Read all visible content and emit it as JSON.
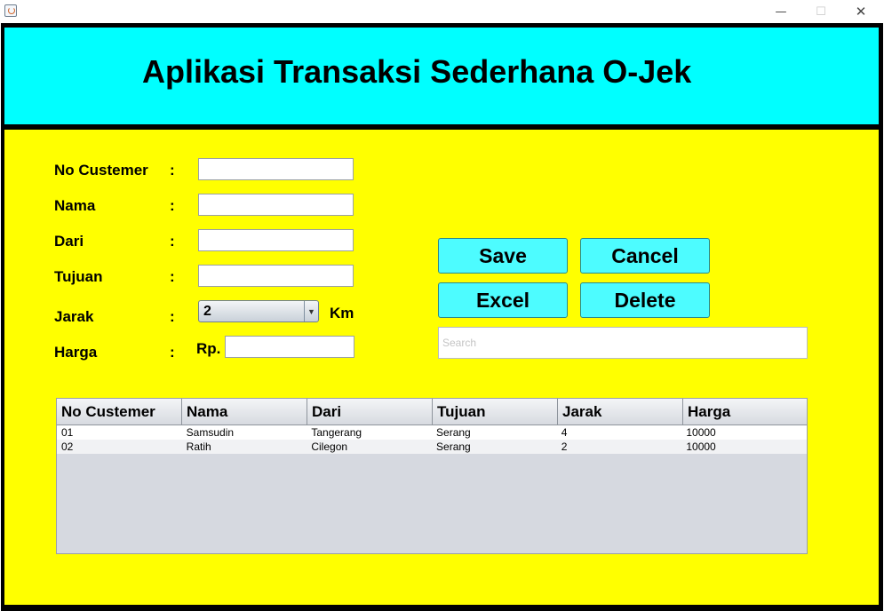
{
  "window": {
    "minimize_glyph": "—",
    "maximize_glyph": "☐",
    "close_glyph": "✕"
  },
  "header": {
    "title": "Aplikasi Transaksi Sederhana O-Jek",
    "background": "#00ffff"
  },
  "form": {
    "colon": ":",
    "no_customer": {
      "label": "No Custemer",
      "value": ""
    },
    "nama": {
      "label": "Nama",
      "value": ""
    },
    "dari": {
      "label": "Dari",
      "value": ""
    },
    "tujuan": {
      "label": "Tujuan",
      "value": ""
    },
    "jarak": {
      "label": "Jarak",
      "selected": "2",
      "unit": "Km"
    },
    "harga": {
      "label": "Harga",
      "prefix": "Rp.",
      "value": ""
    }
  },
  "buttons": {
    "save": "Save",
    "cancel": "Cancel",
    "excel": "Excel",
    "delete": "Delete"
  },
  "search": {
    "placeholder": "Search",
    "value": ""
  },
  "table": {
    "columns": [
      "No Custemer",
      "Nama",
      "Dari",
      "Tujuan",
      "Jarak",
      "Harga"
    ],
    "rows": [
      [
        "01",
        "Samsudin",
        "Tangerang",
        "Serang",
        "4",
        "10000"
      ],
      [
        "02",
        "Ratih",
        "Cilegon",
        "Serang",
        "2",
        "10000"
      ]
    ]
  },
  "colors": {
    "panel_background": "#ffff00",
    "button_background": "#4dfcff",
    "frame_border": "#000000"
  }
}
